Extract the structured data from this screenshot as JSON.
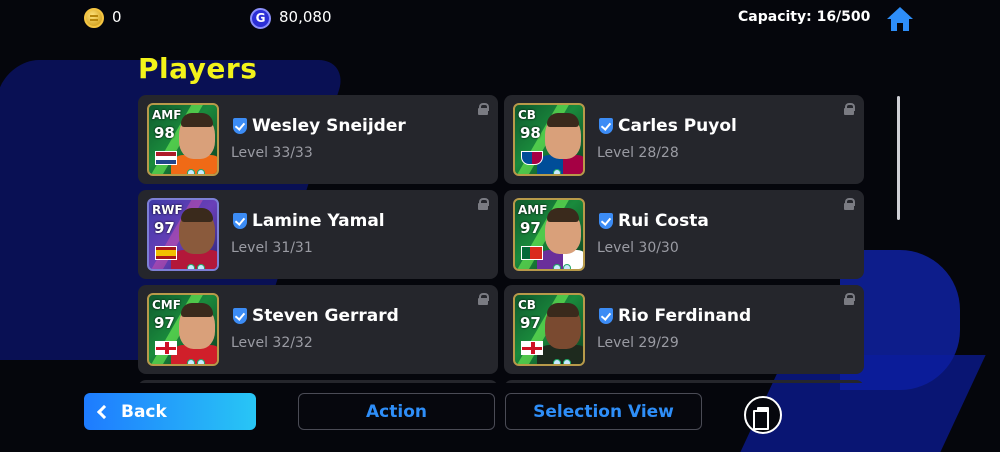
{
  "topbar": {
    "coins_value": "0",
    "gp_icon_letter": "G",
    "gp_value": "80,080",
    "capacity": "Capacity: 16/500"
  },
  "page_title": "Players",
  "players": [
    {
      "name": "Wesley Sneijder",
      "level": "Level 33/33",
      "position": "AMF",
      "rating": "98",
      "flag": "netherlands-flag",
      "card_style": "green"
    },
    {
      "name": "Carles Puyol",
      "level": "Level 28/28",
      "position": "CB",
      "rating": "98",
      "flag": "barcelona-crest",
      "card_style": "green"
    },
    {
      "name": "Lamine Yamal",
      "level": "Level 31/31",
      "position": "RWF",
      "rating": "97",
      "flag": "spain-flag",
      "card_style": "purple"
    },
    {
      "name": "Rui Costa",
      "level": "Level 30/30",
      "position": "AMF",
      "rating": "97",
      "flag": "portugal-flag",
      "card_style": "green"
    },
    {
      "name": "Steven Gerrard",
      "level": "Level 32/32",
      "position": "CMF",
      "rating": "97",
      "flag": "england-flag",
      "card_style": "green"
    },
    {
      "name": "Rio Ferdinand",
      "level": "Level 29/29",
      "position": "CB",
      "rating": "97",
      "flag": "england-flag",
      "card_style": "green"
    }
  ],
  "bottom": {
    "back_label": "Back",
    "action_label": "Action",
    "selection_view_label": "Selection View"
  },
  "colors": {
    "title_yellow": "#f3f31a",
    "accent_blue": "#2e8ef8",
    "card_bg": "#25262c"
  }
}
